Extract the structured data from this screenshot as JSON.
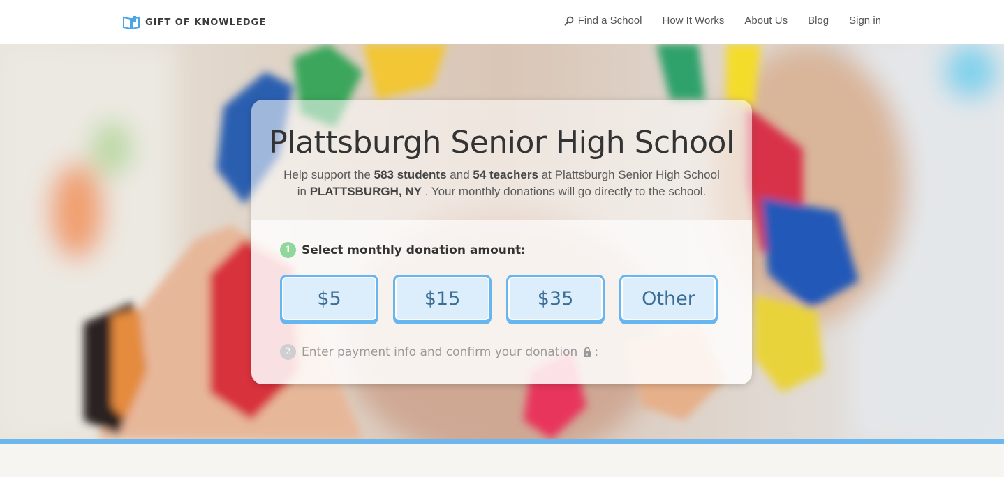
{
  "brand": {
    "name": "GIFT OF KNOWLEDGE",
    "accent": "#68b6f0"
  },
  "nav": {
    "items": [
      {
        "label": "Find a School",
        "icon": "search-icon"
      },
      {
        "label": "How It Works"
      },
      {
        "label": "About Us"
      },
      {
        "label": "Blog"
      },
      {
        "label": "Sign in"
      }
    ]
  },
  "school": {
    "name": "Plattsburgh Senior High School",
    "desc_1": "Help support the",
    "students": "583 students",
    "desc_2": "and",
    "teachers": "54 teachers",
    "desc_3": "at Plattsburgh Senior High School",
    "desc_4": "in",
    "location": "PLATTSBURGH, NY",
    "desc_5": ". Your monthly donations will go directly to the school."
  },
  "donation": {
    "step1": {
      "number": "1",
      "label": "Select monthly donation amount:"
    },
    "amounts": [
      "$5",
      "$15",
      "$35",
      "Other"
    ],
    "step2": {
      "number": "2",
      "label": "Enter payment info and confirm your donation",
      "suffix": ":",
      "icon": "lock-icon"
    }
  }
}
